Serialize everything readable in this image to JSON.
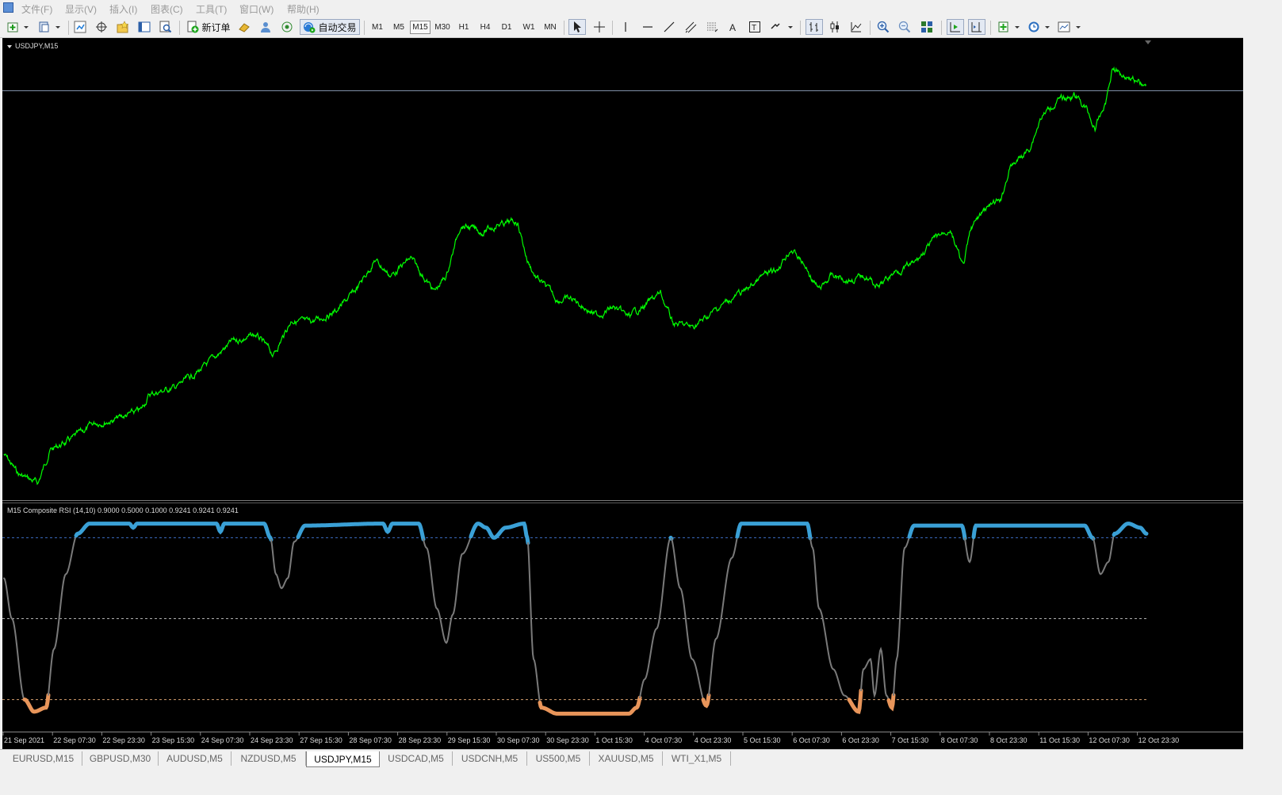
{
  "menu": [
    "文件(F)",
    "显示(V)",
    "插入(I)",
    "图表(C)",
    "工具(T)",
    "窗口(W)",
    "帮助(H)"
  ],
  "toolbar": {
    "new_order_label": "新订单",
    "auto_trade_label": "自动交易",
    "timeframes": [
      "M1",
      "M5",
      "M15",
      "M30",
      "H1",
      "H4",
      "D1",
      "W1",
      "MN"
    ],
    "active_timeframe": "M15"
  },
  "chart": {
    "symbol_label": "USDJPY,M15",
    "price_color": "#00ff00",
    "background_color": "#000000",
    "indicator_label": "M15 Composite RSI (14,10) 0.9000 0.5000 0.1000 0.9241 0.9241 0.9241",
    "indicator_levels": [
      0.9,
      0.5,
      0.1
    ],
    "indicator_colors": {
      "neutral": "#7a7a7a",
      "overbought": "#3aa0d6",
      "oversold": "#e8955a"
    },
    "time_labels": [
      "21 Sep 2021",
      "22 Sep 07:30",
      "22 Sep 23:30",
      "23 Sep 15:30",
      "24 Sep 07:30",
      "24 Sep 23:30",
      "27 Sep 15:30",
      "28 Sep 07:30",
      "28 Sep 23:30",
      "29 Sep 15:30",
      "30 Sep 07:30",
      "30 Sep 23:30",
      "1 Oct 15:30",
      "4 Oct 07:30",
      "4 Oct 23:30",
      "5 Oct 15:30",
      "6 Oct 07:30",
      "6 Oct 23:30",
      "7 Oct 15:30",
      "8 Oct 07:30",
      "8 Oct 23:30",
      "11 Oct 15:30",
      "12 Oct 07:30",
      "12 Oct 23:30"
    ]
  },
  "tabs": [
    "EURUSD,M15",
    "GBPUSD,M30",
    "AUDUSD,M5",
    "NZDUSD,M5",
    "USDJPY,M15",
    "USDCAD,M5",
    "USDCNH,M5",
    "US500,M5",
    "XAUUSD,M5",
    "WTI_X1,M5"
  ],
  "active_tab": "USDJPY,M15"
}
